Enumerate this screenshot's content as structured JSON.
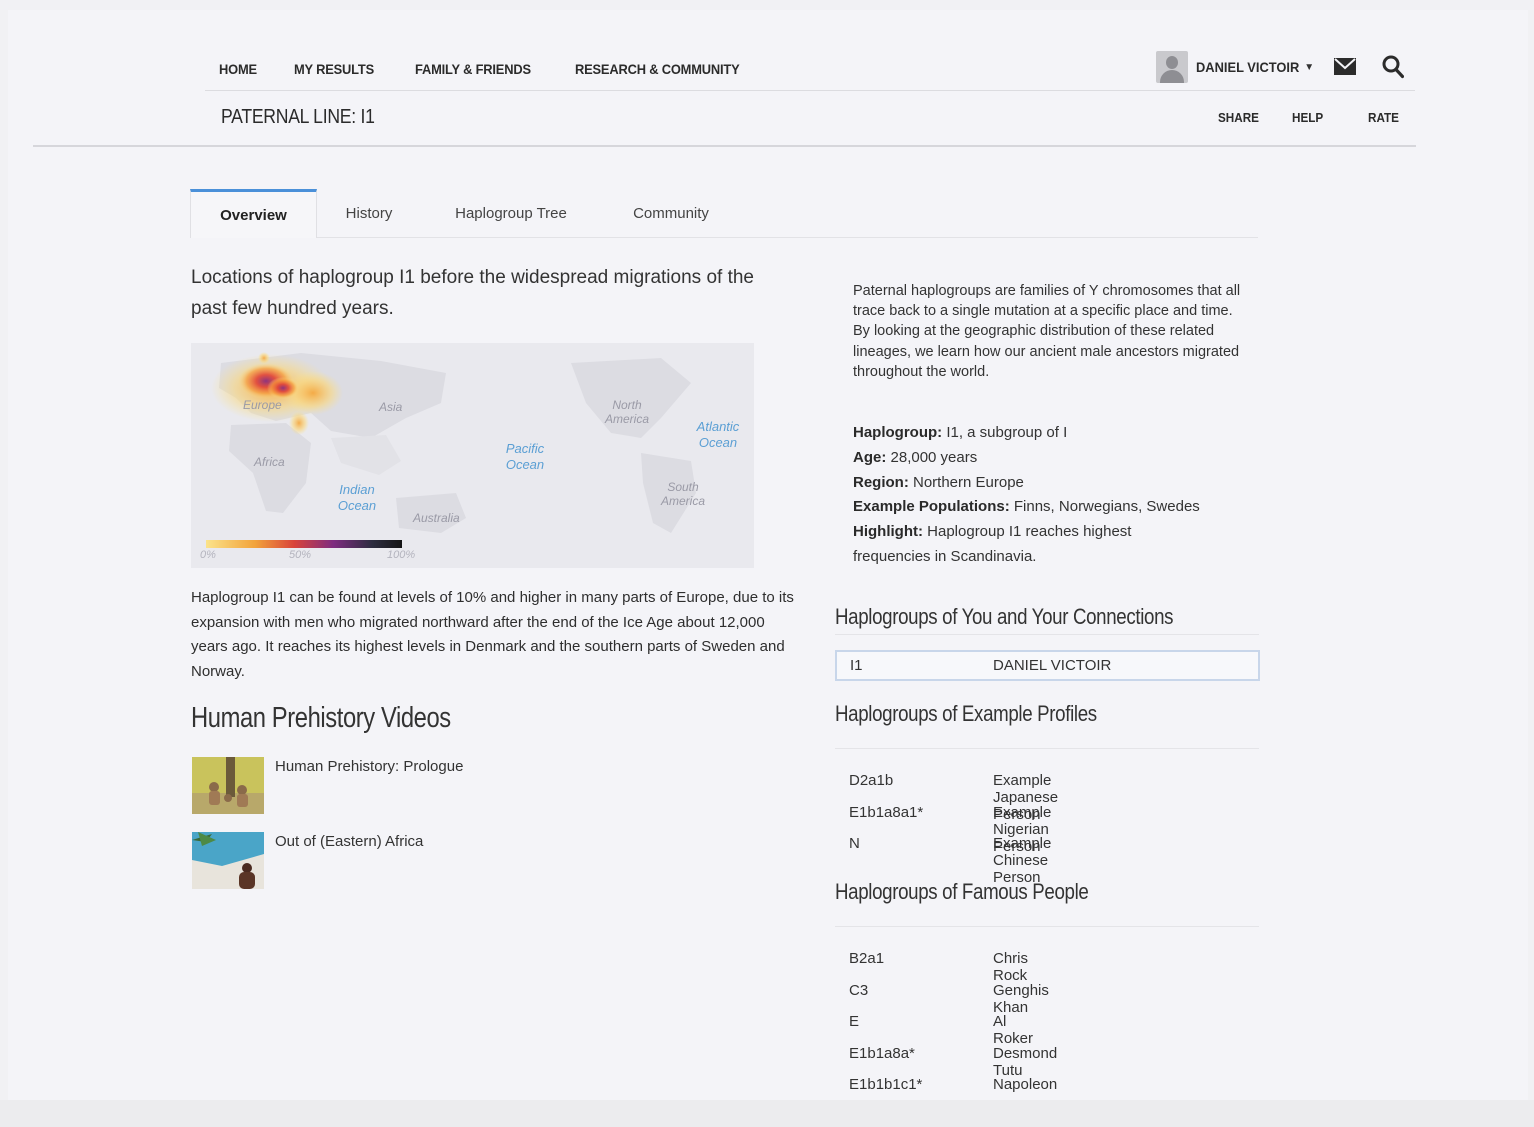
{
  "nav": {
    "items": [
      "HOME",
      "MY RESULTS",
      "FAMILY & FRIENDS",
      "RESEARCH & COMMUNITY"
    ],
    "user_name": "DANIEL VICTOIR"
  },
  "page": {
    "title": "PATERNAL LINE: I1",
    "actions": [
      "SHARE",
      "HELP",
      "RATE"
    ]
  },
  "tabs": [
    "Overview",
    "History",
    "Haplogroup Tree",
    "Community"
  ],
  "map": {
    "caption": "Locations of haplogroup I1 before the widespread migrations of the past few hundred years.",
    "labels": {
      "europe": "Europe",
      "asia": "Asia",
      "africa": "Africa",
      "north_america": "North America",
      "south_america": "South America",
      "australia": "Australia",
      "atlantic": "Atlantic Ocean",
      "pacific": "Pacific Ocean",
      "indian": "Indian Ocean"
    },
    "scale": [
      "0%",
      "50%",
      "100%"
    ]
  },
  "description": "Haplogroup I1 can be found at levels of 10% and higher in many parts of Europe, due to its expansion with men who migrated northward after the end of the Ice Age about 12,000 years ago. It reaches its highest levels in Denmark and the southern parts of Sweden and Norway.",
  "videos": {
    "heading": "Human Prehistory Videos",
    "items": [
      "Human Prehistory: Prologue",
      "Out of (Eastern) Africa"
    ]
  },
  "about": "Paternal haplogroups are families of Y chromosomes that all trace back to a single mutation at a specific place and time. By looking at the geographic distribution of these related lineages, we learn how our ancient male ancestors migrated throughout the world.",
  "facts": {
    "haplogroup_label": "Haplogroup:",
    "haplogroup": "I1, a subgroup of I",
    "age_label": "Age:",
    "age": "28,000 years",
    "region_label": "Region:",
    "region": "Northern Europe",
    "populations_label": "Example Populations:",
    "populations": "Finns, Norwegians, Swedes",
    "highlight_label": "Highlight:",
    "highlight_line1": "Haplogroup I1 reaches highest",
    "highlight_line2": "frequencies in Scandinavia."
  },
  "you": {
    "heading": "Haplogroups of You and Your Connections",
    "haplogroup": "I1",
    "name": "DANIEL VICTOIR"
  },
  "examples": {
    "heading": "Haplogroups of Example Profiles",
    "rows": [
      {
        "hg": "D2a1b",
        "name": "Example Japanese Person"
      },
      {
        "hg": "E1b1a8a1*",
        "name": "Example Nigerian Person"
      },
      {
        "hg": "N",
        "name": "Example Chinese Person"
      }
    ]
  },
  "famous": {
    "heading": "Haplogroups of Famous People",
    "rows": [
      {
        "hg": "B2a1",
        "name": "Chris Rock"
      },
      {
        "hg": "C3",
        "name": "Genghis Khan"
      },
      {
        "hg": "E",
        "name": "Al Roker"
      },
      {
        "hg": "E1b1a8a*",
        "name": "Desmond Tutu"
      },
      {
        "hg": "E1b1b1c1*",
        "name": "Napoleon Bonaparte"
      }
    ]
  }
}
